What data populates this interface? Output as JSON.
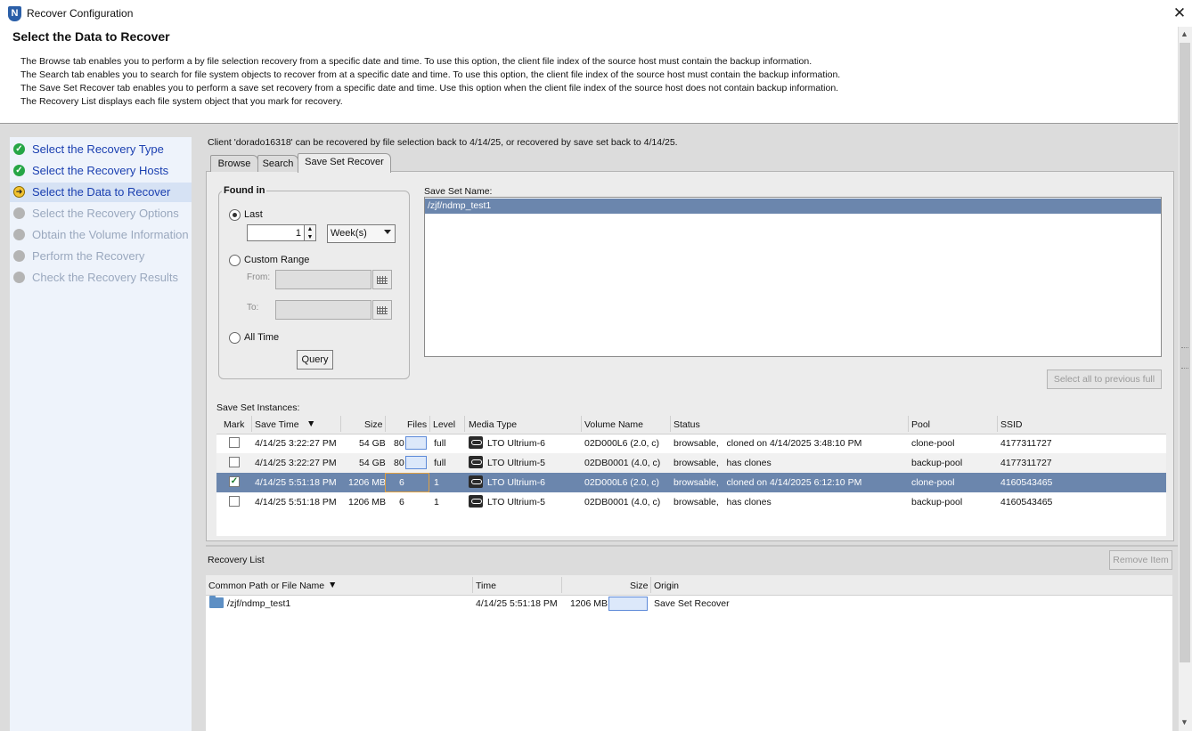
{
  "window": {
    "title": "Recover Configuration",
    "logo_letter": "N"
  },
  "header": {
    "title": "Select the Data to Recover",
    "lines": [
      "The Browse tab enables you to perform a by file selection recovery from a specific date and time. To use this option, the client file index of the source host must contain the backup information.",
      "The Search tab enables you to search for file system objects to recover from at a specific date and time. To use this option, the client file index of the source host must contain the backup information.",
      "The Save Set Recover tab enables you to perform a save set recovery from a specific date and time.  Use this option when the client file index of the source host does not contain backup information.",
      "The Recovery List displays each file system object that you mark for recovery."
    ]
  },
  "wizard": {
    "steps": [
      {
        "label": "Select the Recovery Type",
        "state": "done"
      },
      {
        "label": "Select the Recovery Hosts",
        "state": "done"
      },
      {
        "label": "Select the Data to Recover",
        "state": "current"
      },
      {
        "label": "Select the Recovery Options",
        "state": "pending"
      },
      {
        "label": "Obtain the Volume Information",
        "state": "pending"
      },
      {
        "label": "Perform the Recovery",
        "state": "pending"
      },
      {
        "label": "Check the Recovery Results",
        "state": "pending"
      }
    ]
  },
  "client_message": "Client 'dorado16318' can be recovered by file selection back to 4/14/25, or recovered by save set back to 4/14/25.",
  "tabs": [
    {
      "label": "Browse",
      "selected": false
    },
    {
      "label": "Search",
      "selected": false
    },
    {
      "label": "Save Set Recover",
      "selected": true
    }
  ],
  "found_in": {
    "title": "Found in",
    "last_label": "Last",
    "last_value": "1",
    "unit": "Week(s)",
    "custom_range_label": "Custom Range",
    "from_label": "From:",
    "to_label": "To:",
    "all_time_label": "All Time",
    "selected_option": "Last",
    "query_button": "Query"
  },
  "save_set_name": {
    "label": "Save Set Name:",
    "items": [
      "/zjf/ndmp_test1"
    ],
    "select_all_button": "Select all to previous full"
  },
  "save_set_instances": {
    "label": "Save Set Instances:",
    "columns": [
      "Mark",
      "Save Time",
      "Size",
      "Files",
      "Level",
      "Media Type",
      "Volume Name",
      "Status",
      "Pool",
      "SSID"
    ],
    "rows": [
      {
        "mark": false,
        "save_time": "4/14/25 3:22:27 PM",
        "size": "54 GB",
        "files": "80",
        "level": "full",
        "media_type": "LTO Ultrium-6",
        "volume_name": "02D000L6 (2.0, c)",
        "status": "browsable,   cloned on 4/14/2025 3:48:10 PM",
        "pool": "clone-pool",
        "ssid": "4177311727"
      },
      {
        "mark": false,
        "save_time": "4/14/25 3:22:27 PM",
        "size": "54 GB",
        "files": "80",
        "level": "full",
        "media_type": "LTO Ultrium-5",
        "volume_name": "02DB0001 (4.0, c)",
        "status": "browsable,   has clones",
        "pool": "backup-pool",
        "ssid": "4177311727"
      },
      {
        "mark": true,
        "save_time": "4/14/25 5:51:18 PM",
        "size": "1206 MB",
        "files": "6",
        "level": "1",
        "media_type": "LTO Ultrium-6",
        "volume_name": "02D000L6 (2.0, c)",
        "status": "browsable,   cloned on 4/14/2025 6:12:10 PM",
        "pool": "clone-pool",
        "ssid": "4160543465"
      },
      {
        "mark": false,
        "save_time": "4/14/25 5:51:18 PM",
        "size": "1206 MB",
        "files": "6",
        "level": "1",
        "media_type": "LTO Ultrium-5",
        "volume_name": "02DB0001 (4.0, c)",
        "status": "browsable,   has clones",
        "pool": "backup-pool",
        "ssid": "4160543465"
      }
    ]
  },
  "recovery_list": {
    "label": "Recovery List",
    "remove_button": "Remove Item",
    "columns": [
      "Common Path or File Name",
      "Time",
      "Size",
      "Origin"
    ],
    "rows": [
      {
        "path": "/zjf/ndmp_test1",
        "time": "4/14/25 5:51:18 PM",
        "size": "1206 MB",
        "origin": "Save Set Recover"
      }
    ]
  },
  "colors": {
    "selection": "#6b86ad",
    "wizard_bg": "#eef3fb",
    "done": "#26a646",
    "current": "#f2c230"
  },
  "icons": [
    "app-logo-icon",
    "close-icon",
    "check-circle-icon",
    "arrow-circle-icon",
    "pending-circle-icon",
    "calendar-icon",
    "tape-icon",
    "folder-icon",
    "sort-down-icon"
  ]
}
